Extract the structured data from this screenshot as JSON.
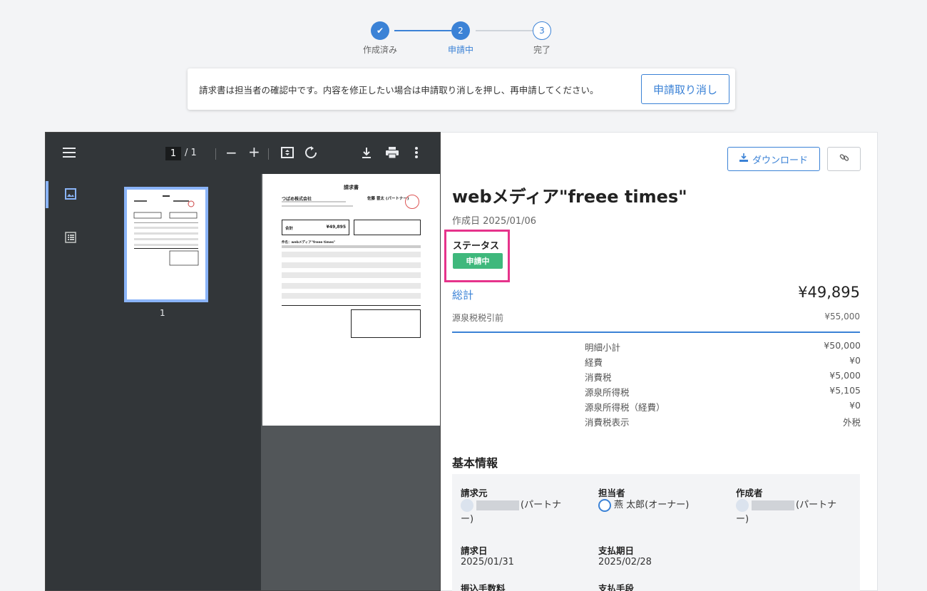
{
  "stepper": {
    "steps": [
      {
        "label": "作成済み",
        "number": "✔"
      },
      {
        "label": "申請中",
        "number": "2"
      },
      {
        "label": "完了",
        "number": "3"
      }
    ]
  },
  "notice": {
    "message": "請求書は担当者の確認中です。内容を修正したい場合は申請取り消しを押し、再申請してください。",
    "cancel_label": "申請取り消し"
  },
  "viewer": {
    "page_current": "1",
    "page_total": "/ 1",
    "thumb_number": "1",
    "doc": {
      "heading": "請求書",
      "company": "つばめ株式会社",
      "sender": "佐藤 晋太 (パートナー)",
      "total_label": "合計",
      "total_value": "¥49,895",
      "subject": "件名：webメディア\"freee times\""
    }
  },
  "panel": {
    "download_label": "ダウンロード",
    "title": "webメディア\"freee times\"",
    "created": "作成日 2025/01/06",
    "status_label": "ステータス",
    "status_value": "申請中",
    "total_label": "総計",
    "total_value": "¥49,895",
    "withholding_label": "源泉税税引前",
    "withholding_value": "¥55,000",
    "breakdown": [
      {
        "label": "明細小計",
        "value": "¥50,000"
      },
      {
        "label": "経費",
        "value": "¥0"
      },
      {
        "label": "消費税",
        "value": "¥5,000"
      },
      {
        "label": "源泉所得税",
        "value": "¥5,105"
      },
      {
        "label": "源泉所得税（経費）",
        "value": "¥0"
      },
      {
        "label": "消費税表示",
        "value": "外税"
      }
    ],
    "section_title": "基本情報",
    "info": {
      "requester_label": "請求元",
      "requester_value": "(パートナー)",
      "assignee_label": "担当者",
      "assignee_value": "燕 太郎(オーナー)",
      "creator_label": "作成者",
      "creator_value": "(パートナー)",
      "invoice_date_label": "請求日",
      "invoice_date_value": "2025/01/31",
      "due_date_label": "支払期日",
      "due_date_value": "2025/02/28",
      "transfer_fee_label": "振込手数料",
      "payment_method_label": "支払手段"
    }
  },
  "colors": {
    "accent": "#3b82d6",
    "status_green": "#3fb87c",
    "highlight": "#e6338b"
  }
}
